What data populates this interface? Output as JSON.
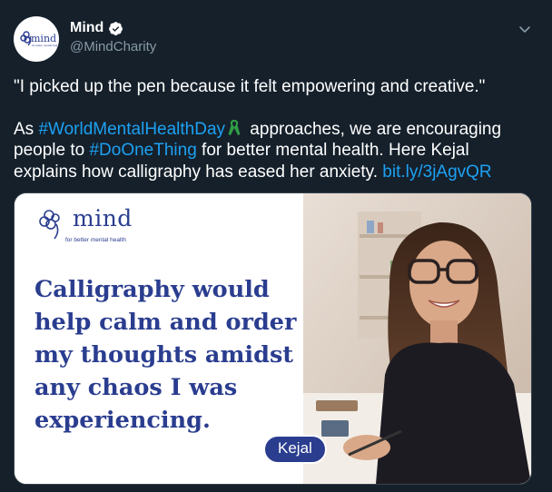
{
  "author": {
    "name": "Mind",
    "handle": "@MindCharity",
    "verified": true,
    "avatar_icon": "mind-logo-icon"
  },
  "tweet": {
    "quote_line": "\"I picked up the pen because it felt empowering and creative.\"",
    "body_prefix": "As ",
    "hashtag1": "#WorldMentalHealthDay",
    "emoji": "green-ribbon-icon",
    "body_mid1": " approaches, we are encouraging people to ",
    "hashtag2": "#DoOneThing",
    "body_mid2": " for better mental health. Here Kejal explains how calligraphy has eased her anxiety. ",
    "link": "bit.ly/3jAgvQR"
  },
  "media": {
    "brand_word": "mind",
    "brand_tagline": "for better mental health",
    "quote_lines": [
      "Calligraphy would",
      "help calm and order",
      "my thoughts amidst",
      "any chaos I was",
      "experiencing."
    ],
    "name_label": "Kejal",
    "photo": "woman-with-glasses-smiling-calligraphy-photo"
  },
  "colors": {
    "background": "#15202b",
    "link": "#1da1f2",
    "secondary_text": "#8899a6",
    "brand_blue": "#2a3d8f"
  }
}
